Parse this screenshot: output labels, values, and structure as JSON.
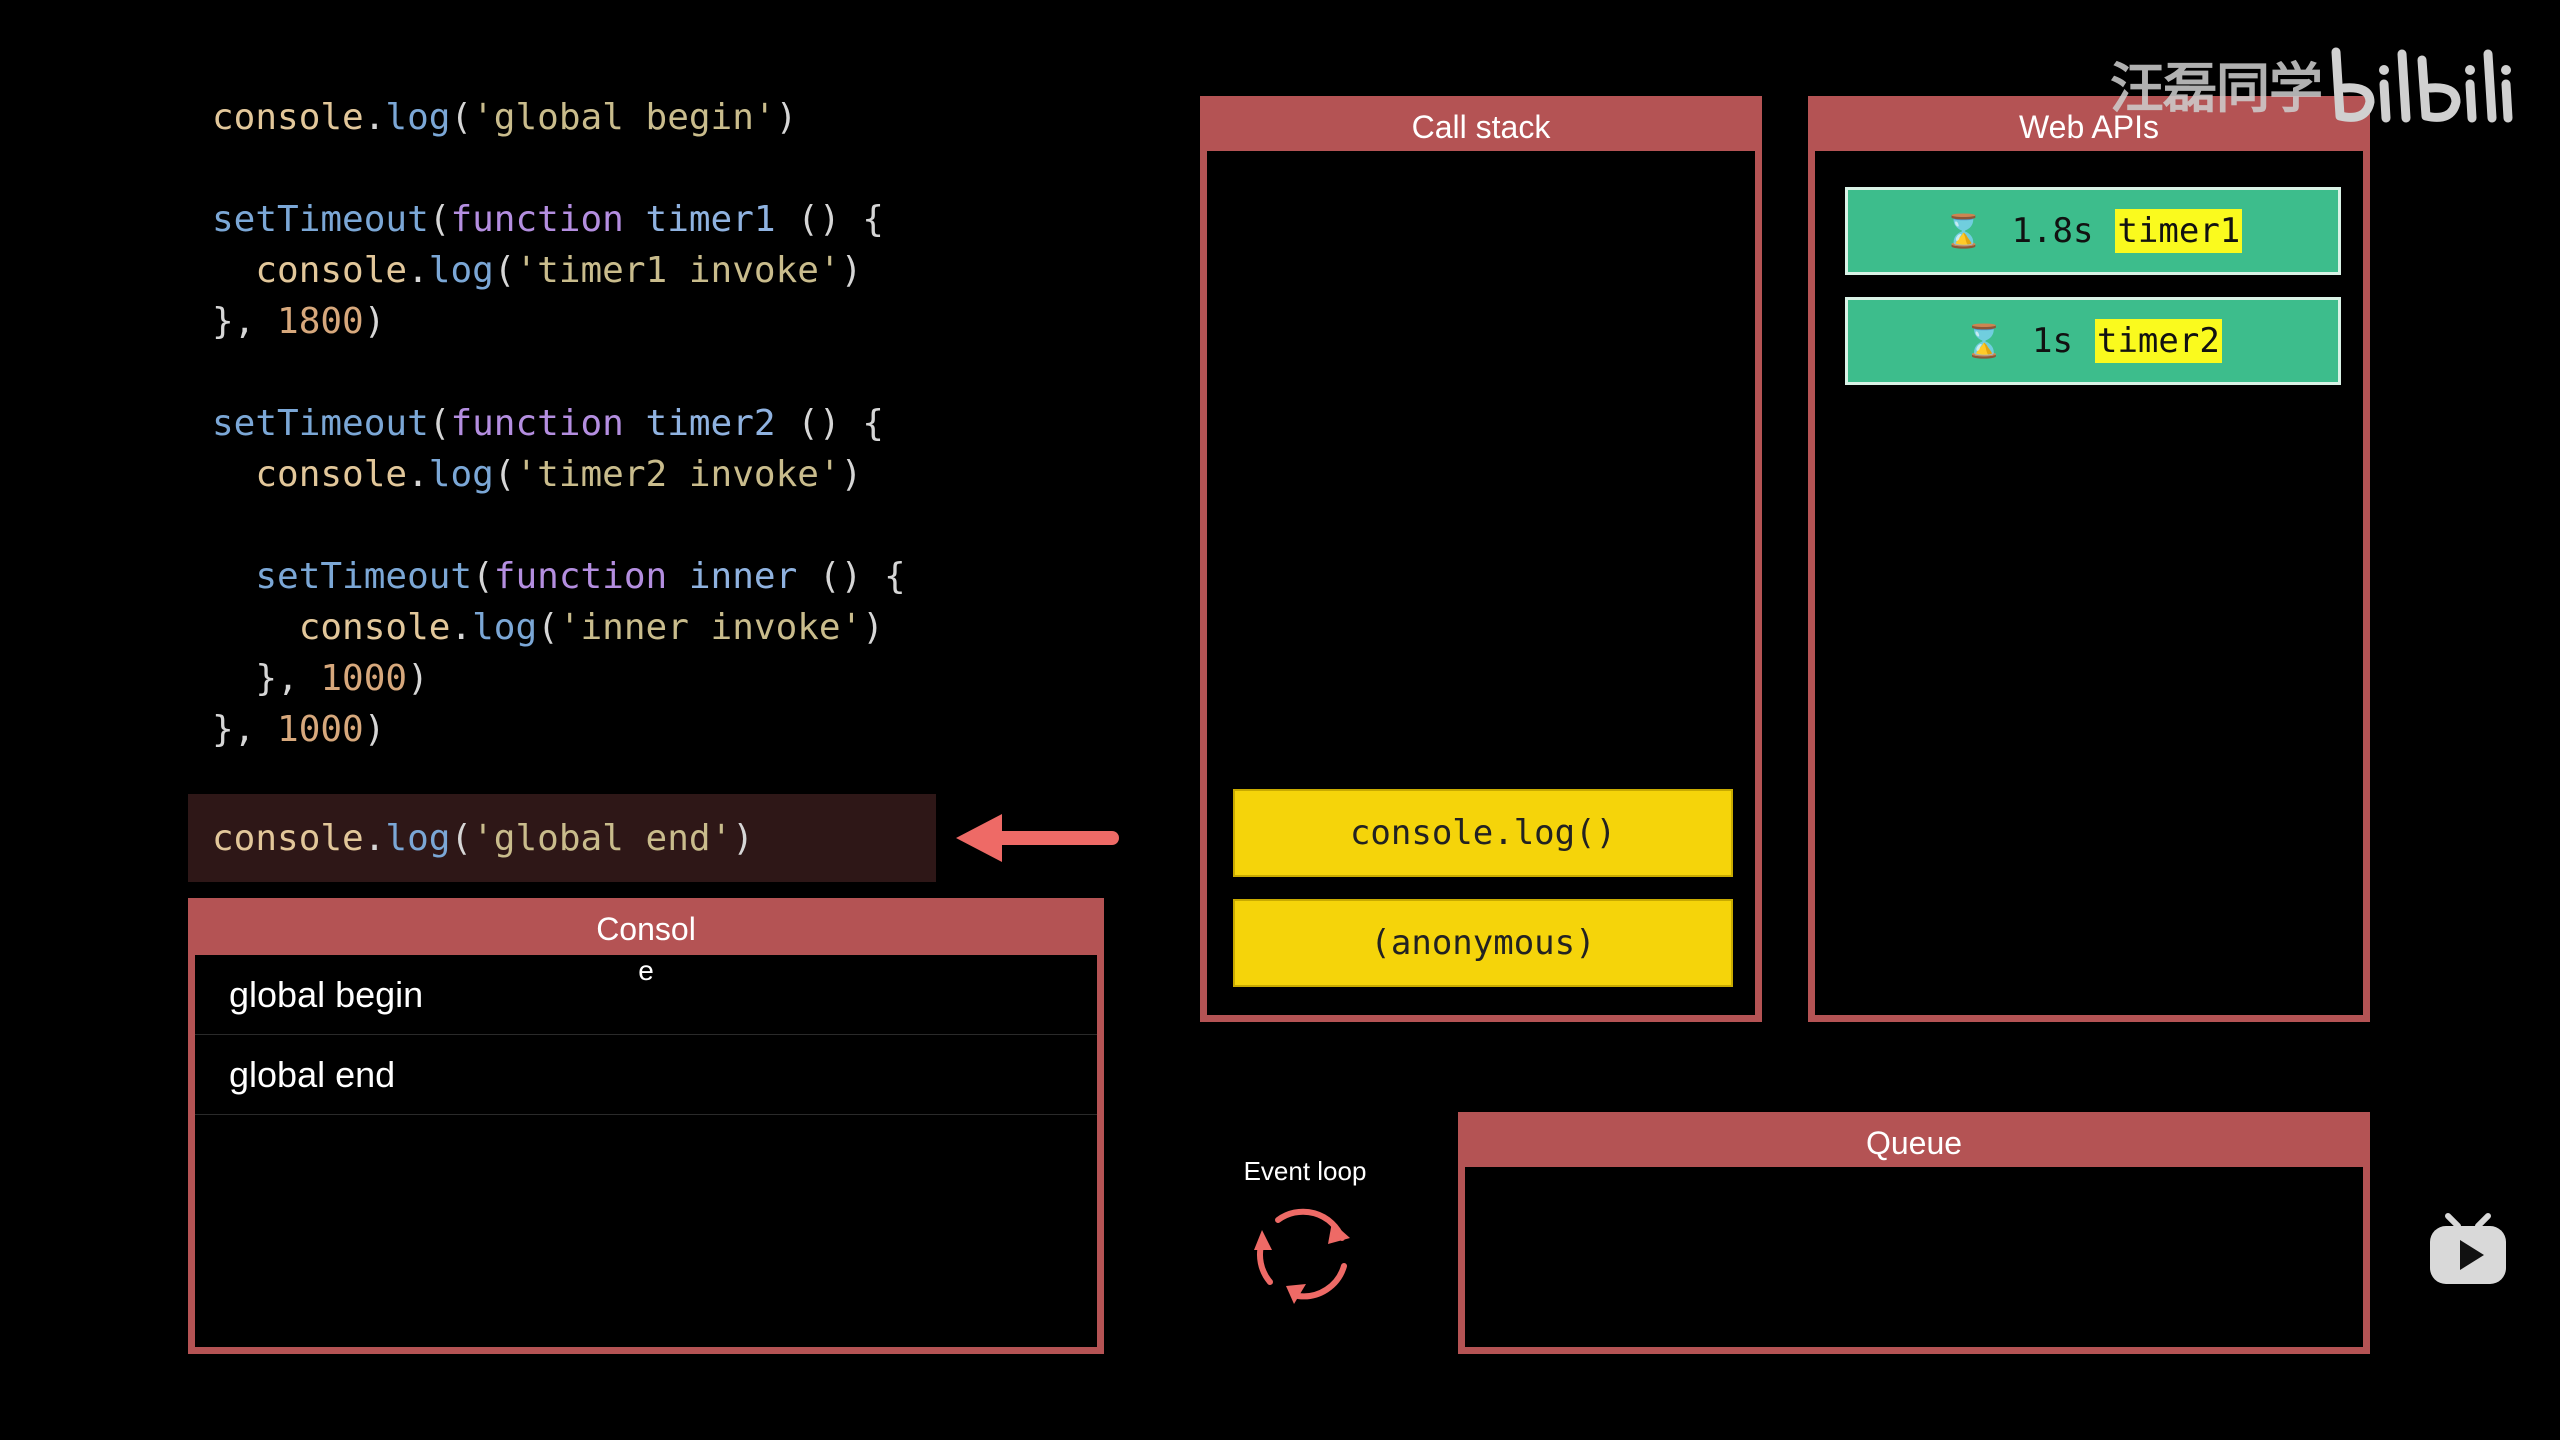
{
  "code": {
    "lines": [
      [
        [
          "tok-obj",
          "console"
        ],
        [
          "tok-p",
          "."
        ],
        [
          "tok-fn",
          "log"
        ],
        [
          "tok-p",
          "("
        ],
        [
          "tok-str",
          "'global begin'"
        ],
        [
          "tok-p",
          ")"
        ]
      ],
      [],
      [
        [
          "tok-fn",
          "setTimeout"
        ],
        [
          "tok-p",
          "("
        ],
        [
          "tok-kw",
          "function"
        ],
        [
          "tok-p",
          " "
        ],
        [
          "tok-name",
          "timer1"
        ],
        [
          "tok-p",
          " () {"
        ]
      ],
      [
        [
          "tok-p",
          "  "
        ],
        [
          "tok-obj",
          "console"
        ],
        [
          "tok-p",
          "."
        ],
        [
          "tok-fn",
          "log"
        ],
        [
          "tok-p",
          "("
        ],
        [
          "tok-str",
          "'timer1 invoke'"
        ],
        [
          "tok-p",
          ")"
        ]
      ],
      [
        [
          "tok-p",
          "}, "
        ],
        [
          "tok-num",
          "1800"
        ],
        [
          "tok-p",
          ")"
        ]
      ],
      [],
      [
        [
          "tok-fn",
          "setTimeout"
        ],
        [
          "tok-p",
          "("
        ],
        [
          "tok-kw",
          "function"
        ],
        [
          "tok-p",
          " "
        ],
        [
          "tok-name",
          "timer2"
        ],
        [
          "tok-p",
          " () {"
        ]
      ],
      [
        [
          "tok-p",
          "  "
        ],
        [
          "tok-obj",
          "console"
        ],
        [
          "tok-p",
          "."
        ],
        [
          "tok-fn",
          "log"
        ],
        [
          "tok-p",
          "("
        ],
        [
          "tok-str",
          "'timer2 invoke'"
        ],
        [
          "tok-p",
          ")"
        ]
      ],
      [],
      [
        [
          "tok-p",
          "  "
        ],
        [
          "tok-fn",
          "setTimeout"
        ],
        [
          "tok-p",
          "("
        ],
        [
          "tok-kw",
          "function"
        ],
        [
          "tok-p",
          " "
        ],
        [
          "tok-name",
          "inner"
        ],
        [
          "tok-p",
          " () {"
        ]
      ],
      [
        [
          "tok-p",
          "    "
        ],
        [
          "tok-obj",
          "console"
        ],
        [
          "tok-p",
          "."
        ],
        [
          "tok-fn",
          "log"
        ],
        [
          "tok-p",
          "("
        ],
        [
          "tok-str",
          "'inner invoke'"
        ],
        [
          "tok-p",
          ")"
        ]
      ],
      [
        [
          "tok-p",
          "  }, "
        ],
        [
          "tok-num",
          "1000"
        ],
        [
          "tok-p",
          ")"
        ]
      ],
      [
        [
          "tok-p",
          "}, "
        ],
        [
          "tok-num",
          "1000"
        ],
        [
          "tok-p",
          ")"
        ]
      ]
    ],
    "highlighted_line": [
      [
        "tok-obj",
        "console"
      ],
      [
        "tok-p",
        "."
      ],
      [
        "tok-fn",
        "log"
      ],
      [
        "tok-p",
        "("
      ],
      [
        "tok-str",
        "'global end'"
      ],
      [
        "tok-p",
        ")"
      ]
    ]
  },
  "console_panel": {
    "title": "Consol",
    "title_wrap": "e",
    "rows": [
      "global begin",
      "global end"
    ]
  },
  "call_stack": {
    "title": "Call stack",
    "items": [
      "console.log()",
      "(anonymous)"
    ]
  },
  "web_apis": {
    "title": "Web APIs",
    "timers": [
      {
        "time": "1.8s",
        "name": "timer1",
        "icon": "hourglass-icon"
      },
      {
        "time": "1s",
        "name": "timer2",
        "icon": "hourglass-icon"
      }
    ]
  },
  "queue": {
    "title": "Queue"
  },
  "event_loop": {
    "label": "Event loop",
    "icon": "refresh-loop-icon"
  },
  "watermark": {
    "text": "汪磊同学",
    "logo": "bilibili"
  },
  "colors": {
    "panel_red": "#b45354",
    "stack_yellow": "#f5d40a",
    "timer_green": "#3dbd8c",
    "highlight_yellow": "#fafa1e",
    "arrow": "#ee6a66"
  }
}
